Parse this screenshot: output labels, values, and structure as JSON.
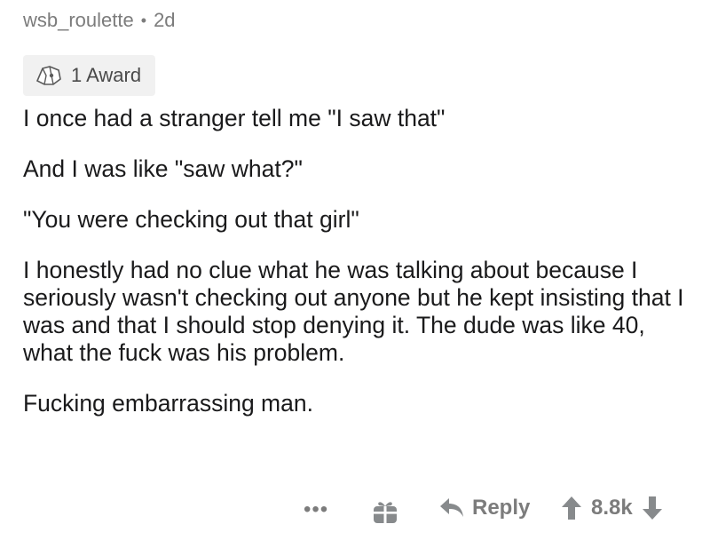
{
  "comment": {
    "author": "wsb_roulette",
    "separator": "•",
    "age": "2d",
    "award_label": "1 Award",
    "award_icon": "award-icon",
    "paragraphs": [
      "I once had a stranger tell me \"I saw that\"",
      "And I was like \"saw what?\"",
      "\"You were checking out that girl\"",
      "I honestly had no clue what he was talking about because I seriously wasn't checking out anyone but he kept insisting that I was and that I should stop denying it. The dude was like 40, what the fuck was his problem.",
      "Fucking embarrassing man."
    ]
  },
  "actions": {
    "more_label": "•••",
    "reply_label": "Reply",
    "score": "8.8k",
    "icon_color": "#878a8c"
  }
}
